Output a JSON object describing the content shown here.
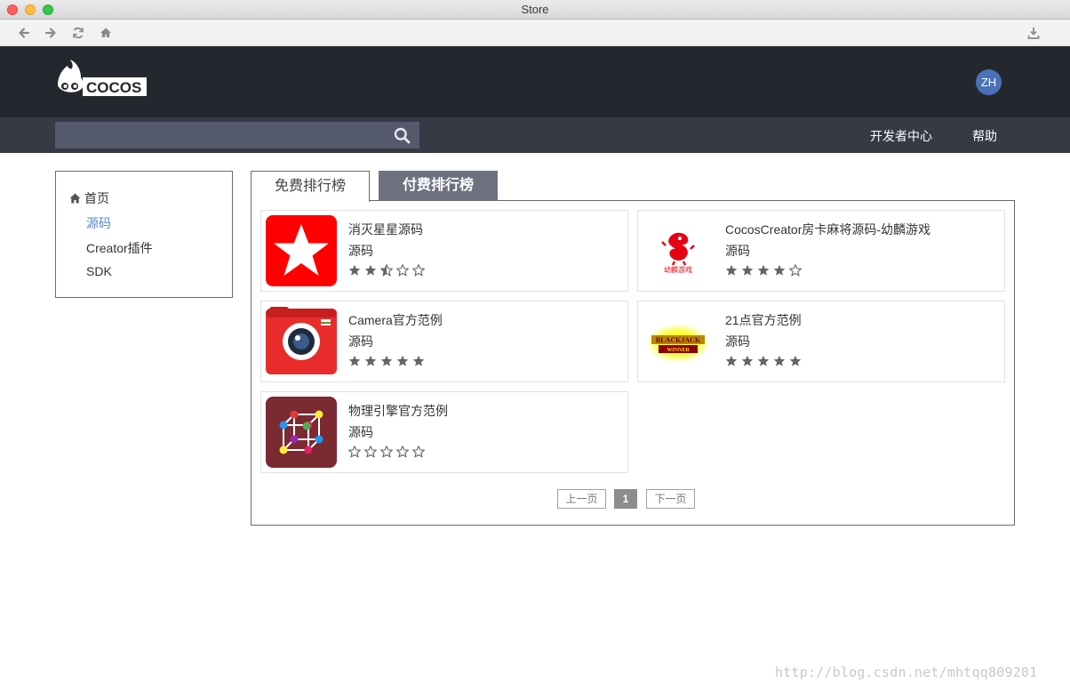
{
  "window": {
    "title": "Store"
  },
  "header": {
    "brand": "COCOS",
    "avatar_initials": "ZH"
  },
  "nav": {
    "search_placeholder": "",
    "links": [
      "开发者中心",
      "帮助"
    ]
  },
  "sidebar": {
    "items": [
      {
        "label": "首页",
        "icon": "home-icon"
      },
      {
        "label": "源码",
        "active": true
      },
      {
        "label": "Creator插件"
      },
      {
        "label": "SDK"
      }
    ]
  },
  "tabs": [
    {
      "label": "免费排行榜",
      "active": true
    },
    {
      "label": "付费排行榜",
      "active": false
    }
  ],
  "products": [
    {
      "name": "消灭星星源码",
      "category": "源码",
      "rating": 2.5
    },
    {
      "name": "CocosCreator房卡麻将源码-幼麟游戏",
      "category": "源码",
      "rating": 4
    },
    {
      "name": "Camera官方范例",
      "category": "源码",
      "rating": 5
    },
    {
      "name": "21点官方范例",
      "category": "源码",
      "rating": 5
    },
    {
      "name": "物理引擎官方范例",
      "category": "源码",
      "rating": 0
    }
  ],
  "thumb_text": {
    "youlin": "幼麟游戏",
    "blackjack_top": "BLACKJACK",
    "blackjack_bottom": "WINNER"
  },
  "pagination": {
    "prev": "上一页",
    "current": "1",
    "next": "下一页"
  },
  "watermark": "http://blog.csdn.net/mhtqq809201",
  "colors": {
    "header_bg": "#25272e",
    "nav_bg": "#373a44",
    "accent_link": "#5a86d0",
    "star": "#666666"
  }
}
